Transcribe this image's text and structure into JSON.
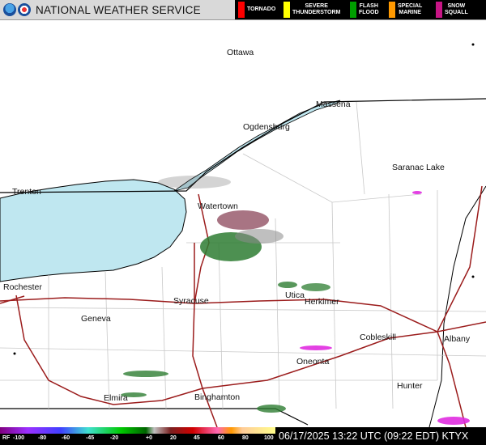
{
  "header": {
    "agency": "NATIONAL WEATHER SERVICE",
    "logos": [
      "noaa-logo",
      "nws-logo"
    ]
  },
  "warning_legend": [
    {
      "line1": "TORNADO",
      "line2": "",
      "color": "#ff0000"
    },
    {
      "line1": "SEVERE",
      "line2": "THUNDERSTORM",
      "color": "#ffff00"
    },
    {
      "line1": "FLASH",
      "line2": "FLOOD",
      "color": "#00a000"
    },
    {
      "line1": "SPECIAL",
      "line2": "MARINE",
      "color": "#ff9900"
    },
    {
      "line1": "SNOW",
      "line2": "SQUALL",
      "color": "#c71585"
    }
  ],
  "map": {
    "cities": [
      "Ottawa",
      "Massena",
      "Ogdensburg",
      "Saranac Lake",
      "Trenton",
      "Watertown",
      "Rochester",
      "Syracuse",
      "Utica",
      "Herkimer",
      "Geneva",
      "Cobleskill",
      "Albany",
      "Oneonta",
      "Hunter",
      "Elmira",
      "Binghamton"
    ],
    "colors": {
      "water": "#bfe7f0",
      "borders": "#000000",
      "highways": "#9b1c1c",
      "counties": "#c8c8c8"
    }
  },
  "scale": {
    "labels": [
      "RF",
      "-100",
      "-80",
      "-60",
      "-45",
      "-20",
      "+0",
      "20",
      "45",
      "60",
      "80",
      "100"
    ]
  },
  "footer": {
    "timestamp": "06/17/2025 13:22 UTC (09:22 EDT)",
    "radar_site": "KTYX"
  }
}
